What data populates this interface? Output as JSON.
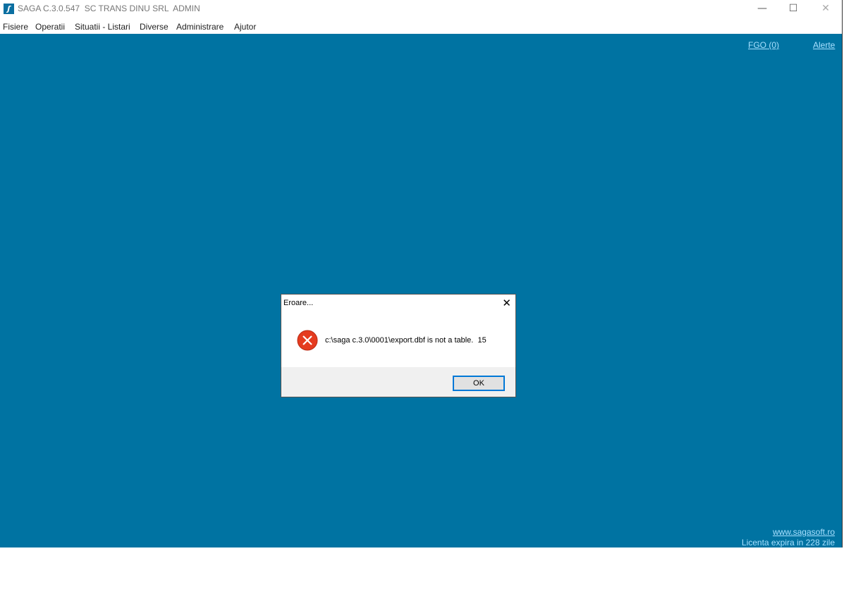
{
  "window": {
    "title": "SAGA C.3.0.547  SC TRANS DINU SRL  ADMIN",
    "app_icon": "saga-logo-icon",
    "controls": {
      "minimize": "—",
      "maximize": "☐",
      "close": "✕"
    }
  },
  "menu": {
    "items": [
      {
        "label": "Fisiere"
      },
      {
        "label": "Operatii"
      },
      {
        "label": "Situatii - Listari"
      },
      {
        "label": "Diverse"
      },
      {
        "label": "Administrare"
      },
      {
        "label": "Ajutor"
      }
    ]
  },
  "desktop": {
    "background_color": "#0073a2",
    "fgo_link": "FGO (0)",
    "alerts_link": "Alerte",
    "site_link": "www.sagasoft.ro",
    "license_text": "Licenta expira in 228 zile"
  },
  "dialog": {
    "title": "Eroare...",
    "close_glyph": "✕",
    "icon": "error-icon",
    "message": "c:\\saga c.3.0\\0001\\export.dbf is not a table.  15",
    "ok_label": "OK"
  }
}
